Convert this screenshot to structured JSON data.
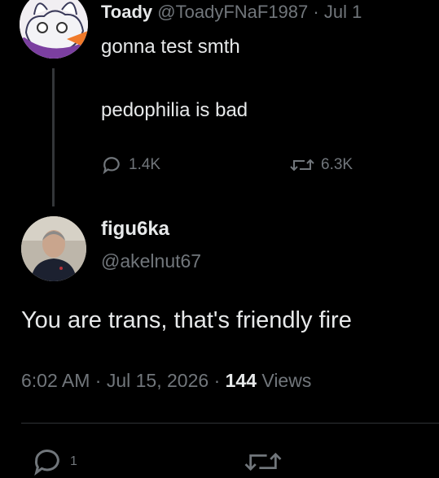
{
  "parent_tweet": {
    "display_name": "Toady",
    "handle": "@ToadyFNaF1987",
    "separator": "·",
    "date": "Jul 1",
    "text_lines": [
      "gonna test smth",
      "pedophilia is bad"
    ],
    "replies": "1.4K",
    "retweets": "6.3K"
  },
  "reply_tweet": {
    "display_name": "figu6ka",
    "handle": "@akelnut67",
    "text": "You are trans, that's friendly fire",
    "time": "6:02 AM",
    "separator": "·",
    "date": "Jul 15, 2026",
    "separator2": "·",
    "views_count": "144",
    "views_label": "Views",
    "replies": "1"
  },
  "colors": {
    "background": "#000000",
    "text": "#e7e9ea",
    "muted": "#71767b"
  },
  "icons": [
    "reply-icon",
    "retweet-icon"
  ]
}
